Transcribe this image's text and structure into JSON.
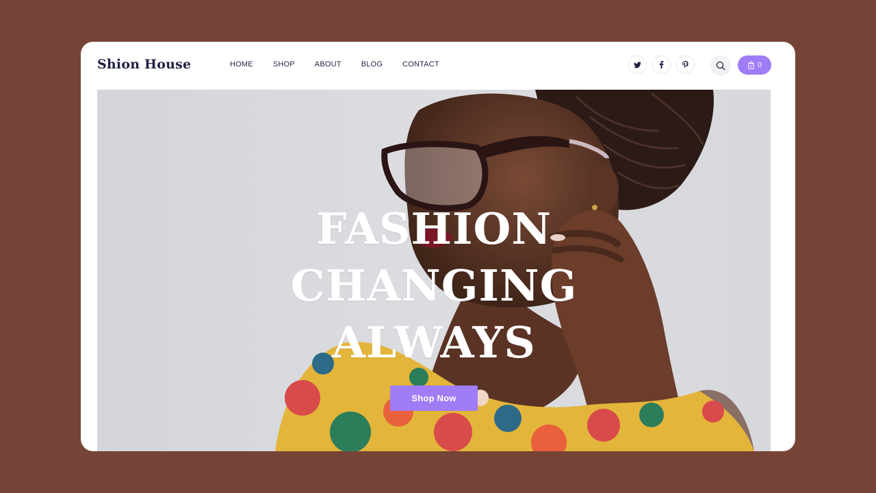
{
  "brand": {
    "logo": "Shion House"
  },
  "nav": {
    "items": [
      {
        "label": "HOME"
      },
      {
        "label": "SHOP"
      },
      {
        "label": "ABOUT"
      },
      {
        "label": "BLOG"
      },
      {
        "label": "CONTACT"
      }
    ]
  },
  "socials": [
    {
      "icon": "twitter-icon"
    },
    {
      "icon": "facebook-icon"
    },
    {
      "icon": "pinterest-icon"
    }
  ],
  "search": {
    "icon": "search-icon"
  },
  "cart": {
    "icon": "shopping-bag-icon",
    "count": "0"
  },
  "hero": {
    "title_lines": [
      "FASHION",
      "CHANGING",
      "ALWAYS"
    ],
    "cta_label": "Shop Now"
  },
  "colors": {
    "page_background": "#764436",
    "accent": "#a07cf7",
    "text_dark": "#1f2240"
  }
}
